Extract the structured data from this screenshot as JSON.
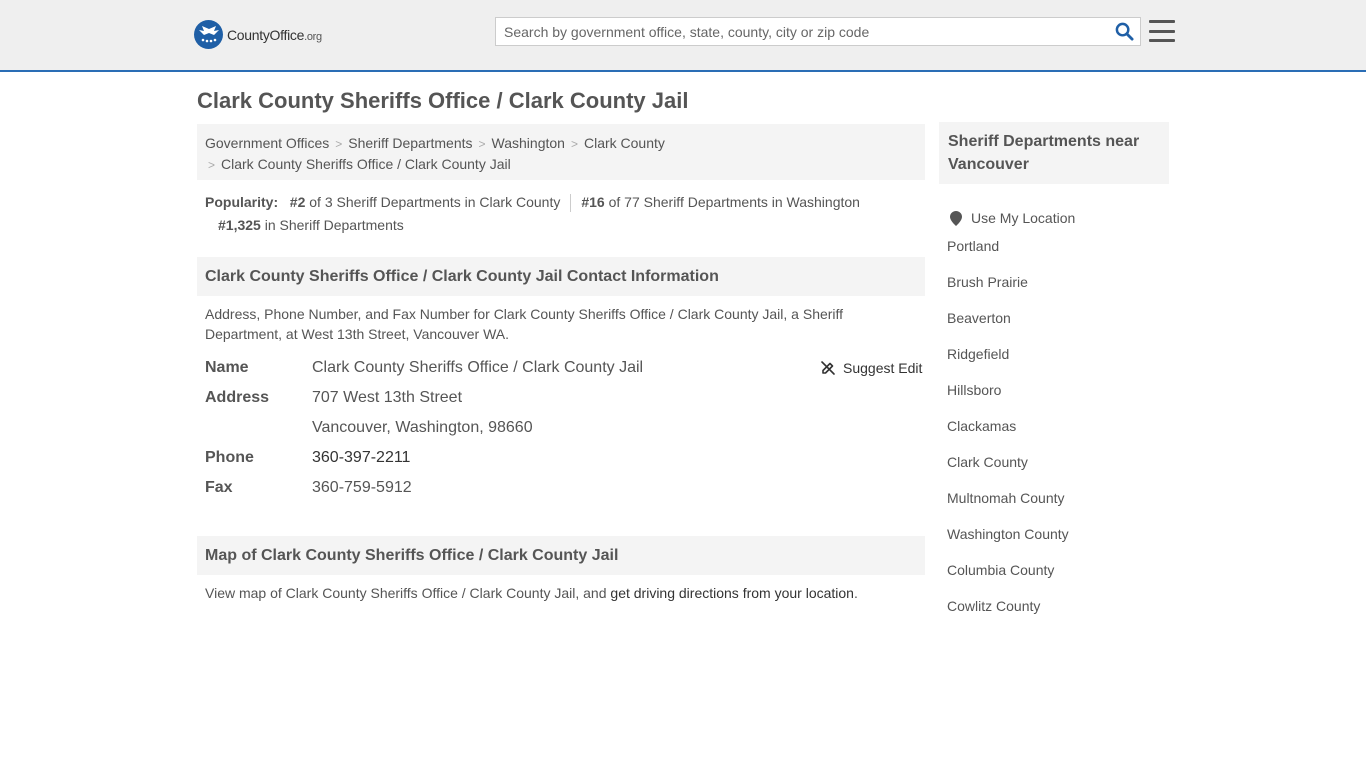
{
  "header": {
    "logo_main": "CountyOffice",
    "logo_tld": ".org",
    "search_placeholder": "Search by government office, state, county, city or zip code"
  },
  "page_title": "Clark County Sheriffs Office / Clark County Jail",
  "breadcrumb": {
    "items": [
      "Government Offices",
      "Sheriff Departments",
      "Washington",
      "Clark County"
    ],
    "current": "Clark County Sheriffs Office / Clark County Jail"
  },
  "popularity": {
    "label": "Popularity:",
    "rank1": "#2",
    "rank1_text": "of 3 Sheriff Departments in Clark County",
    "rank2": "#16",
    "rank2_text": "of 77 Sheriff Departments in Washington",
    "rank3": "#1,325",
    "rank3_text": "in Sheriff Departments"
  },
  "contact": {
    "heading": "Clark County Sheriffs Office / Clark County Jail Contact Information",
    "description": "Address, Phone Number, and Fax Number for Clark County Sheriffs Office / Clark County Jail, a Sheriff Department, at West 13th Street, Vancouver WA.",
    "suggest_edit": "Suggest Edit",
    "name_label": "Name",
    "name_value": "Clark County Sheriffs Office / Clark County Jail",
    "address_label": "Address",
    "address_line1": "707 West 13th Street",
    "address_line2": "Vancouver, Washington, 98660",
    "phone_label": "Phone",
    "phone_value": "360-397-2211",
    "fax_label": "Fax",
    "fax_value": "360-759-5912"
  },
  "map": {
    "heading": "Map of Clark County Sheriffs Office / Clark County Jail",
    "text_before": "View map of Clark County Sheriffs Office / Clark County Jail, and",
    "link": "get driving directions from your location",
    "text_after": "."
  },
  "sidebar": {
    "heading": "Sheriff Departments near Vancouver",
    "use_location": "Use My Location",
    "links": [
      "Portland",
      "Brush Prairie",
      "Beaverton",
      "Ridgefield",
      "Hillsboro",
      "Clackamas",
      "Clark County",
      "Multnomah County",
      "Washington County",
      "Columbia County",
      "Cowlitz County"
    ]
  }
}
